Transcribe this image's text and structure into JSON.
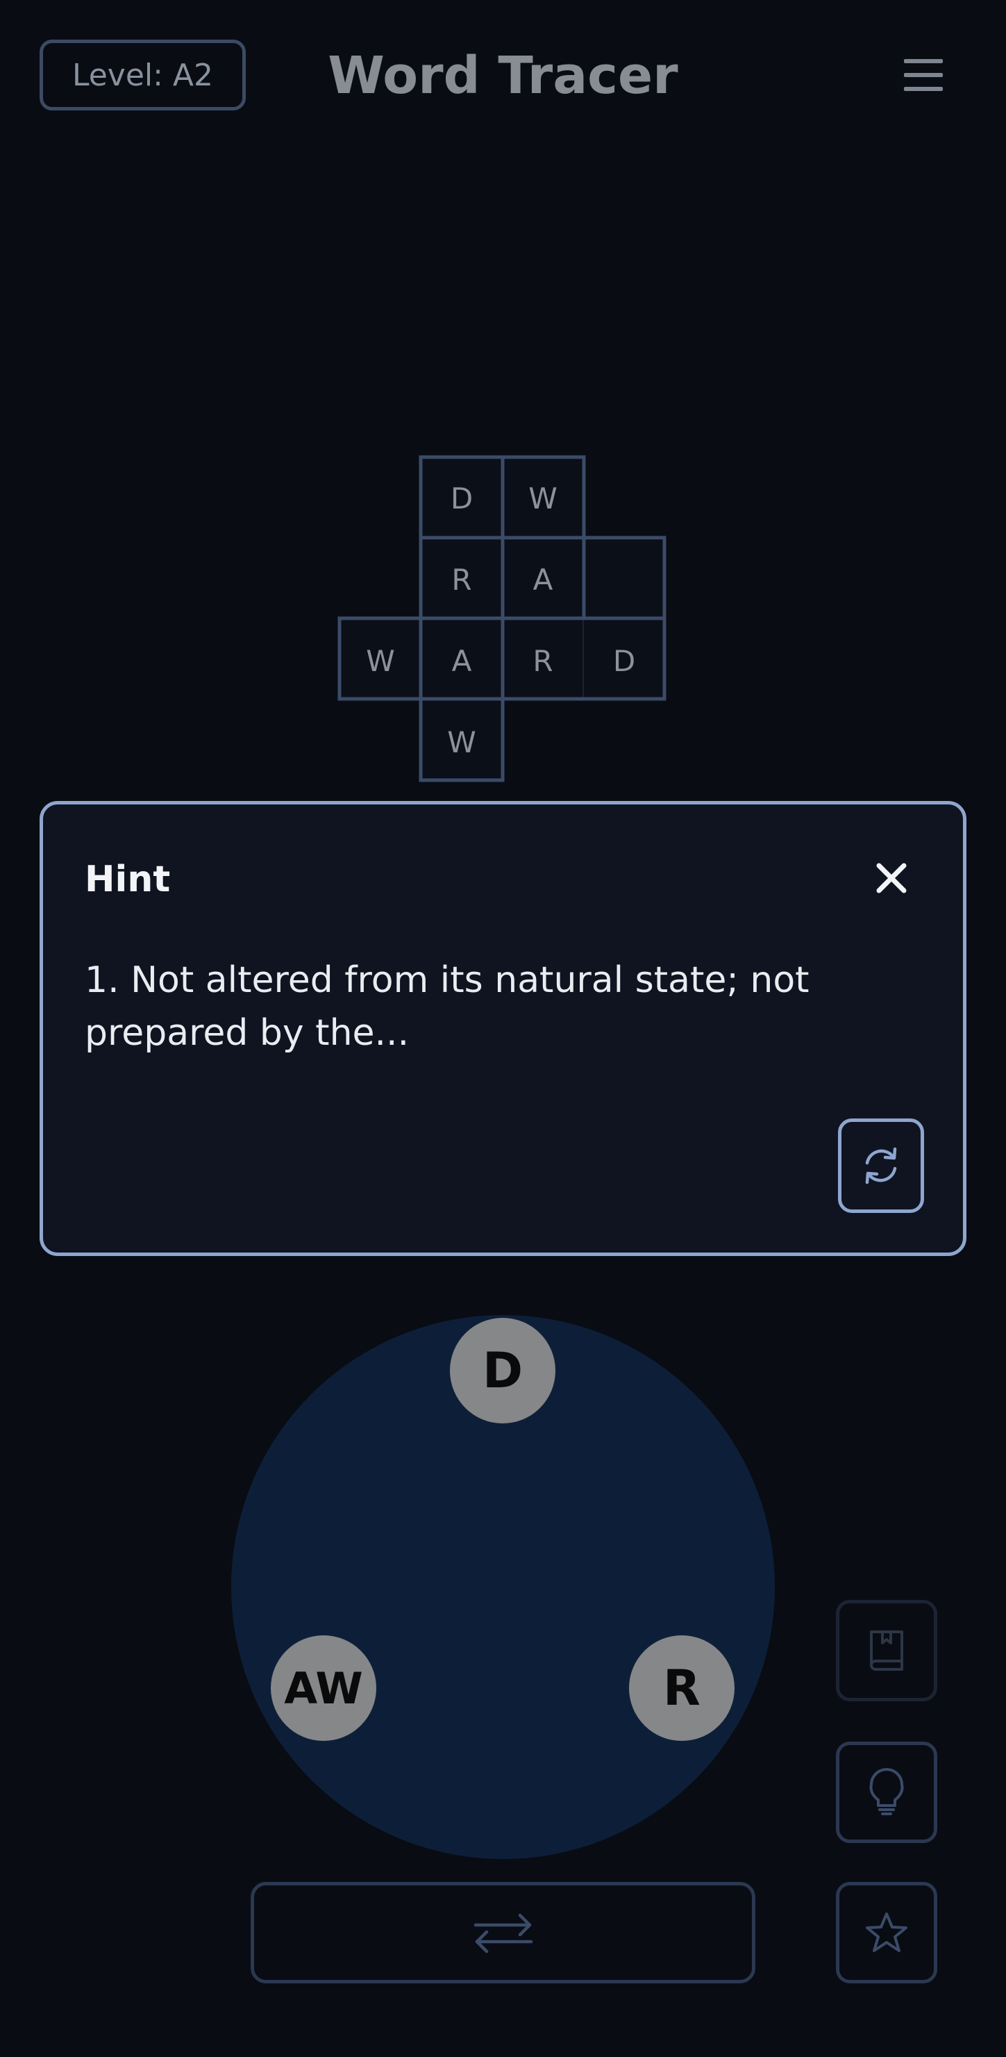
{
  "header": {
    "level_label": "Level: A2",
    "title": "Word Tracer",
    "menu_icon": "hamburger-menu-icon"
  },
  "crossword": {
    "cells": [
      {
        "row": 0,
        "col": 1,
        "letter": "D"
      },
      {
        "row": 0,
        "col": 2,
        "letter": "W"
      },
      {
        "row": 1,
        "col": 1,
        "letter": "R"
      },
      {
        "row": 1,
        "col": 2,
        "letter": "A"
      },
      {
        "row": 1,
        "col": 3,
        "letter": ""
      },
      {
        "row": 2,
        "col": 0,
        "letter": "W"
      },
      {
        "row": 2,
        "col": 1,
        "letter": "A"
      },
      {
        "row": 2,
        "col": 2,
        "letter": "R"
      },
      {
        "row": 2,
        "col": 3,
        "letter": "D"
      },
      {
        "row": 3,
        "col": 1,
        "letter": "W"
      }
    ]
  },
  "hint": {
    "title": "Hint",
    "text": "1. Not altered from its natural state; not prepared by the...",
    "close_icon": "close-icon",
    "refresh_icon": "refresh-icon"
  },
  "wheel": {
    "letters": [
      "D",
      "R",
      "AW"
    ]
  },
  "controls": {
    "dictionary_icon": "book-icon",
    "hint_icon": "lightbulb-icon",
    "favorite_icon": "star-icon",
    "shuffle_icon": "shuffle-arrows-icon"
  },
  "colors": {
    "background": "#090c13",
    "panel_border": "#8ea6cf",
    "wheel": "#0d1f38",
    "grid_border": "#3b4b68",
    "letter_bubble": "#858789"
  }
}
